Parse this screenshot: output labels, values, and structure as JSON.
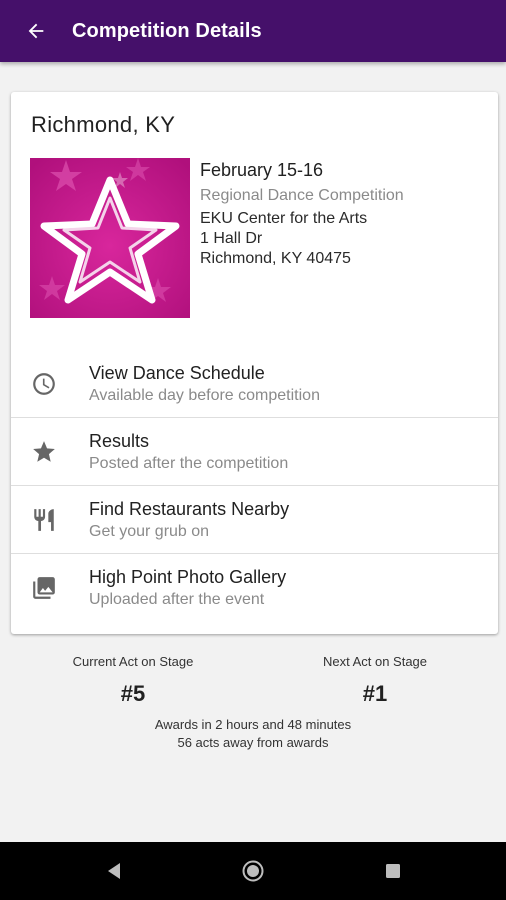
{
  "appbar": {
    "title": "Competition Details"
  },
  "competition": {
    "city": "Richmond, KY",
    "dates": "February 15-16",
    "type": "Regional Dance Competition",
    "venue_name": "EKU Center for the Arts",
    "address_line1": "1 Hall Dr",
    "address_line2": "Richmond, KY 40475"
  },
  "menu": [
    {
      "icon": "clock-icon",
      "title": "View Dance Schedule",
      "subtitle": "Available day before competition"
    },
    {
      "icon": "star-icon",
      "title": "Results",
      "subtitle": "Posted after the competition"
    },
    {
      "icon": "restaurant-icon",
      "title": "Find Restaurants Nearby",
      "subtitle": "Get your grub on"
    },
    {
      "icon": "photo-library-icon",
      "title": "High Point Photo Gallery",
      "subtitle": "Uploaded after the event"
    }
  ],
  "stats": {
    "current_label": "Current Act on Stage",
    "current_value": "#5",
    "next_label": "Next Act on Stage",
    "next_value": "#1",
    "awards_time": "Awards in 2 hours and 48 minutes",
    "awards_acts": "56 acts away from awards"
  },
  "colors": {
    "appbar": "#45106a",
    "logo_bg": "#c21a8c",
    "icon": "#666666"
  }
}
